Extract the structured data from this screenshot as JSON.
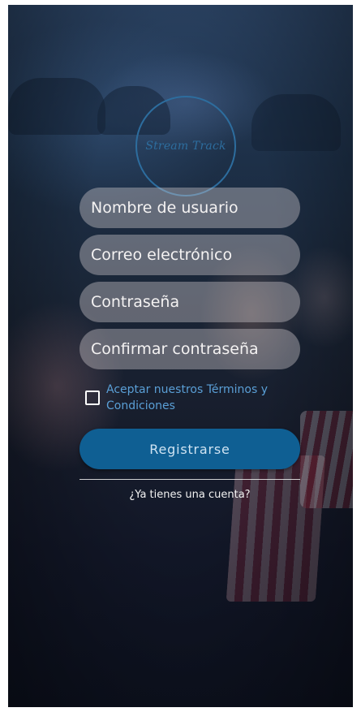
{
  "app": {
    "logo_text": "Stream Track"
  },
  "form": {
    "username_placeholder": "Nombre de usuario",
    "email_placeholder": "Correo electrónico",
    "password_placeholder": "Contraseña",
    "confirm_password_placeholder": "Confirmar contraseña",
    "terms_label": "Aceptar nuestros Términos y Condiciones",
    "terms_checked": false,
    "register_label": "Registrarse",
    "login_link": "¿Ya tienes una cuenta?"
  },
  "colors": {
    "accent": "#0f5f93",
    "logo": "#2d6d9e",
    "terms_text": "#5a9fd6"
  },
  "icons": {
    "checkbox": "checkbox-unchecked-icon"
  }
}
